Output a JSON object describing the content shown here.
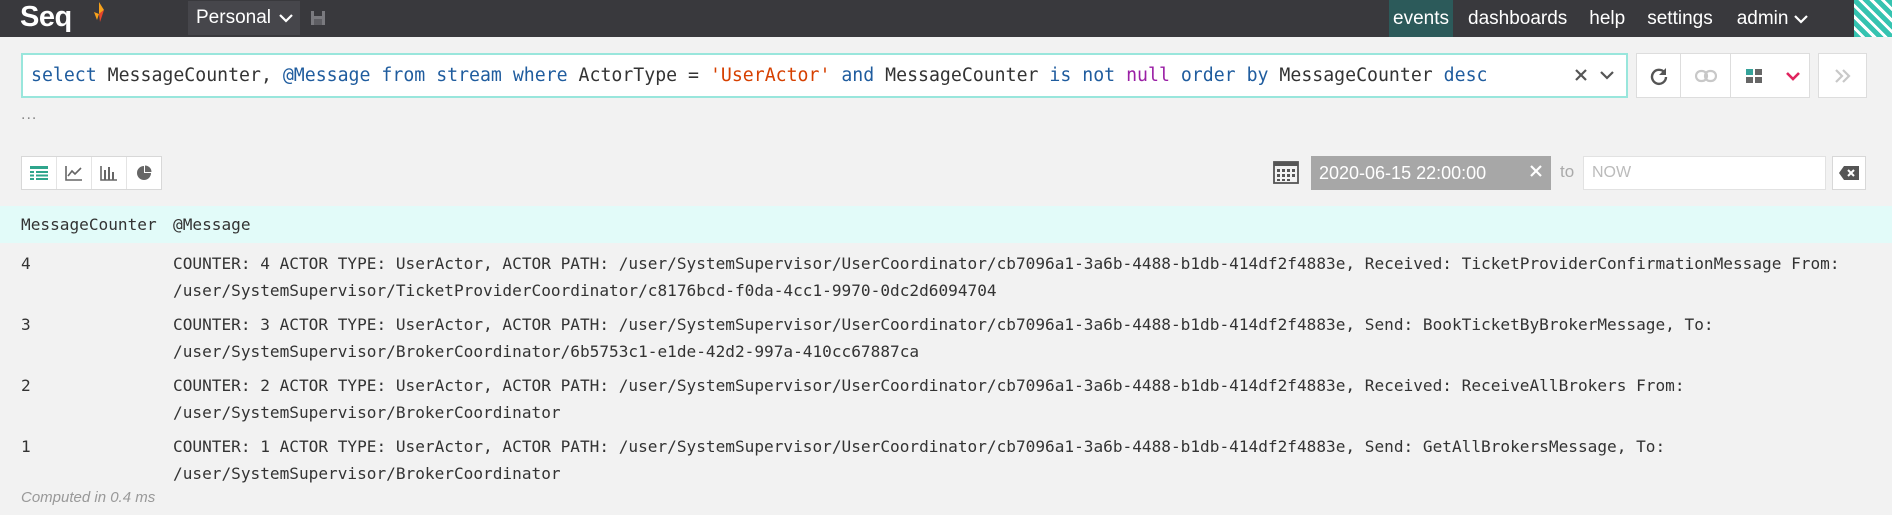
{
  "app": {
    "logo": "Seq"
  },
  "workspace": {
    "label": "Personal"
  },
  "nav": {
    "items": [
      {
        "label": "events",
        "active": true
      },
      {
        "label": "dashboards",
        "active": false
      },
      {
        "label": "help",
        "active": false
      },
      {
        "label": "settings",
        "active": false
      },
      {
        "label": "admin",
        "active": false
      }
    ]
  },
  "query": {
    "tokens": [
      {
        "t": "select",
        "c": "kw"
      },
      {
        "t": " MessageCounter, ",
        "c": "id"
      },
      {
        "t": "@Message",
        "c": "prop"
      },
      {
        "t": " ",
        "c": "id"
      },
      {
        "t": "from",
        "c": "kw"
      },
      {
        "t": " ",
        "c": "id"
      },
      {
        "t": "stream",
        "c": "kw"
      },
      {
        "t": " ",
        "c": "id"
      },
      {
        "t": "where",
        "c": "kw"
      },
      {
        "t": " ActorType = ",
        "c": "id"
      },
      {
        "t": "'UserActor'",
        "c": "str"
      },
      {
        "t": " ",
        "c": "id"
      },
      {
        "t": "and",
        "c": "kw"
      },
      {
        "t": " MessageCounter ",
        "c": "id"
      },
      {
        "t": "is",
        "c": "kw"
      },
      {
        "t": " ",
        "c": "id"
      },
      {
        "t": "not",
        "c": "kw"
      },
      {
        "t": " ",
        "c": "id"
      },
      {
        "t": "null",
        "c": "nul"
      },
      {
        "t": " ",
        "c": "id"
      },
      {
        "t": "order",
        "c": "kw"
      },
      {
        "t": " ",
        "c": "id"
      },
      {
        "t": "by",
        "c": "kw"
      },
      {
        "t": " MessageCounter ",
        "c": "id"
      },
      {
        "t": "desc",
        "c": "kw"
      }
    ],
    "ellipsis": "..."
  },
  "range": {
    "from": "2020-06-15 22:00:00",
    "to_label": "to",
    "to_placeholder": "NOW"
  },
  "results": {
    "columns": [
      "MessageCounter",
      "@Message"
    ],
    "rows": [
      {
        "counter": "4",
        "message": "COUNTER: 4 ACTOR TYPE: UserActor, ACTOR PATH: /user/SystemSupervisor/UserCoordinator/cb7096a1-3a6b-4488-b1db-414df2f4883e, Received: TicketProviderConfirmationMessage From:\n/user/SystemSupervisor/TicketProviderCoordinator/c8176bcd-f0da-4cc1-9970-0dc2d6094704"
      },
      {
        "counter": "3",
        "message": "COUNTER: 3 ACTOR TYPE: UserActor, ACTOR PATH: /user/SystemSupervisor/UserCoordinator/cb7096a1-3a6b-4488-b1db-414df2f4883e, Send: BookTicketByBrokerMessage, To:\n/user/SystemSupervisor/BrokerCoordinator/6b5753c1-e1de-42d2-997a-410cc67887ca"
      },
      {
        "counter": "2",
        "message": "COUNTER: 2 ACTOR TYPE: UserActor, ACTOR PATH: /user/SystemSupervisor/UserCoordinator/cb7096a1-3a6b-4488-b1db-414df2f4883e, Received: ReceiveAllBrokers From:\n/user/SystemSupervisor/BrokerCoordinator"
      },
      {
        "counter": "1",
        "message": "COUNTER: 1 ACTOR TYPE: UserActor, ACTOR PATH: /user/SystemSupervisor/UserCoordinator/cb7096a1-3a6b-4488-b1db-414df2f4883e, Send: GetAllBrokersMessage, To:\n/user/SystemSupervisor/BrokerCoordinator"
      }
    ],
    "computed": "Computed in 0.4 ms"
  },
  "icons": {
    "flame": "seq-flame-icon",
    "save": "floppy-disk-icon",
    "refresh": "refresh-icon",
    "link": "link-icon",
    "dashboard": "dashboard-icon",
    "expand": "chevron-down-icon",
    "forward": "double-chevron-right-icon",
    "calendar": "calendar-icon",
    "backspace": "backspace-icon"
  },
  "colors": {
    "topbar": "#39393d",
    "active_nav": "#2c5a5a",
    "accent_teal": "#35c3b0",
    "query_border": "#99e6dc",
    "result_header": "#e2fbf9",
    "keyword": "#1f5c9e",
    "string": "#d64000",
    "null": "#9a1fa5",
    "expand_chevron": "#e0245e"
  }
}
